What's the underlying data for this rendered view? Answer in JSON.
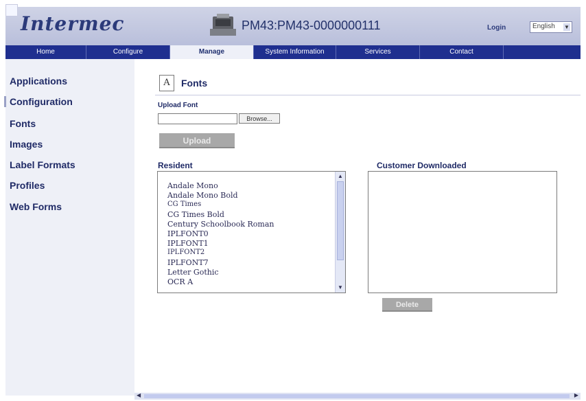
{
  "header": {
    "logo": "Intermec",
    "device_name": "PM43:PM43-0000000111",
    "login": "Login",
    "language": "English"
  },
  "nav": {
    "items": [
      "Home",
      "Configure",
      "Manage",
      "System Information",
      "Services",
      "Contact"
    ],
    "active": "Manage"
  },
  "sidebar": {
    "items": [
      "Applications",
      "Configuration",
      "Fonts",
      "Images",
      "Label Formats",
      "Profiles",
      "Web Forms"
    ]
  },
  "main": {
    "title": "Fonts",
    "upload_label": "Upload Font",
    "browse_label": "Browse...",
    "upload_button": "Upload",
    "resident_label": "Resident",
    "customer_label": "Customer Downloaded",
    "delete_button": "Delete",
    "resident_fonts": [
      "Andale Mono",
      "Andale Mono Bold",
      "CG Times",
      "CG Times Bold",
      "Century Schoolbook Roman",
      "IPLFONT0",
      "IPLFONT1",
      "IPLFONT2",
      "IPLFONT7",
      "Letter Gothic",
      "OCR A"
    ]
  }
}
